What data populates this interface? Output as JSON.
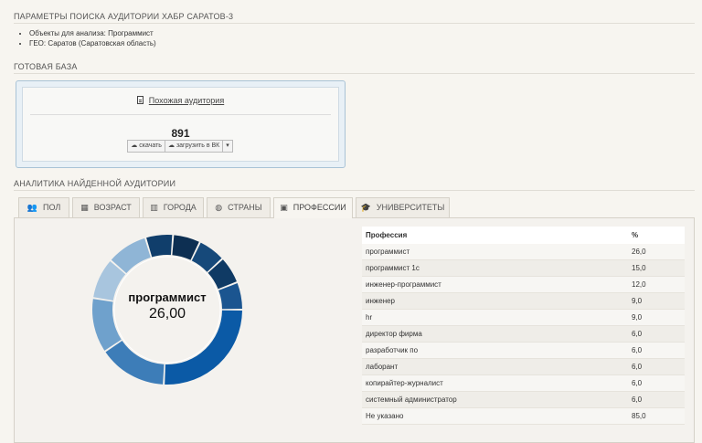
{
  "params": {
    "title": "ПАРАМЕТРЫ ПОИСКА АУДИТОРИИ ХАБР САРАТОВ-3",
    "items": [
      "Объекты для анализа: Программист",
      "ГЕО: Саратов (Саратовская область)"
    ]
  },
  "base": {
    "title": "ГОТОВАЯ БАЗА",
    "similar_link": "Похожая аудитория",
    "count": "891",
    "download_label": "скачать",
    "upload_label": "загрузить в ВК",
    "caret": "▾"
  },
  "analytics": {
    "title": "АНАЛИТИКА НАЙДЕННОЙ АУДИТОРИИ",
    "tabs": [
      {
        "label": "ПОЛ",
        "icon": "users-icon",
        "glyph": "👥",
        "active": false
      },
      {
        "label": "ВОЗРАСТ",
        "icon": "calendar-icon",
        "glyph": "▦",
        "active": false
      },
      {
        "label": "ГОРОДА",
        "icon": "building-icon",
        "glyph": "▥",
        "active": false
      },
      {
        "label": "СТРАНЫ",
        "icon": "globe-icon",
        "glyph": "◍",
        "active": false
      },
      {
        "label": "ПРОФЕССИИ",
        "icon": "briefcase-icon",
        "glyph": "▣",
        "active": true
      },
      {
        "label": "УНИВЕРСИТЕТЫ",
        "icon": "graduation-cap-icon",
        "glyph": "🎓",
        "active": false
      }
    ]
  },
  "chart_data": {
    "type": "pie",
    "center_label": "программист",
    "center_value": "26,00",
    "categories": [
      "программист",
      "программист 1с",
      "инженер-программист",
      "инженер",
      "hr",
      "директор фирма",
      "разработчик по",
      "лаборант",
      "копирайтер-журналист",
      "системный администратор"
    ],
    "values": [
      26,
      15,
      12,
      9,
      9,
      6,
      6,
      6,
      6,
      6
    ],
    "colors": [
      "#0b5aa6",
      "#3d7db8",
      "#6fa1cc",
      "#a8c5de",
      "#8fb5d6",
      "#103e6b",
      "#0d2f52",
      "#16497a",
      "#0f3a64",
      "#1b5590"
    ]
  },
  "table": {
    "headers": [
      "Профессия",
      "%"
    ],
    "rows": [
      [
        "программист",
        "26,0"
      ],
      [
        "программист 1с",
        "15,0"
      ],
      [
        "инженер-программист",
        "12,0"
      ],
      [
        "инженер",
        "9,0"
      ],
      [
        "hr",
        "9,0"
      ],
      [
        "директор фирма",
        "6,0"
      ],
      [
        "разработчик по",
        "6,0"
      ],
      [
        "лаборант",
        "6,0"
      ],
      [
        "копирайтер-журналист",
        "6,0"
      ],
      [
        "системный администратор",
        "6,0"
      ],
      [
        "Не указано",
        "85,0"
      ]
    ]
  }
}
